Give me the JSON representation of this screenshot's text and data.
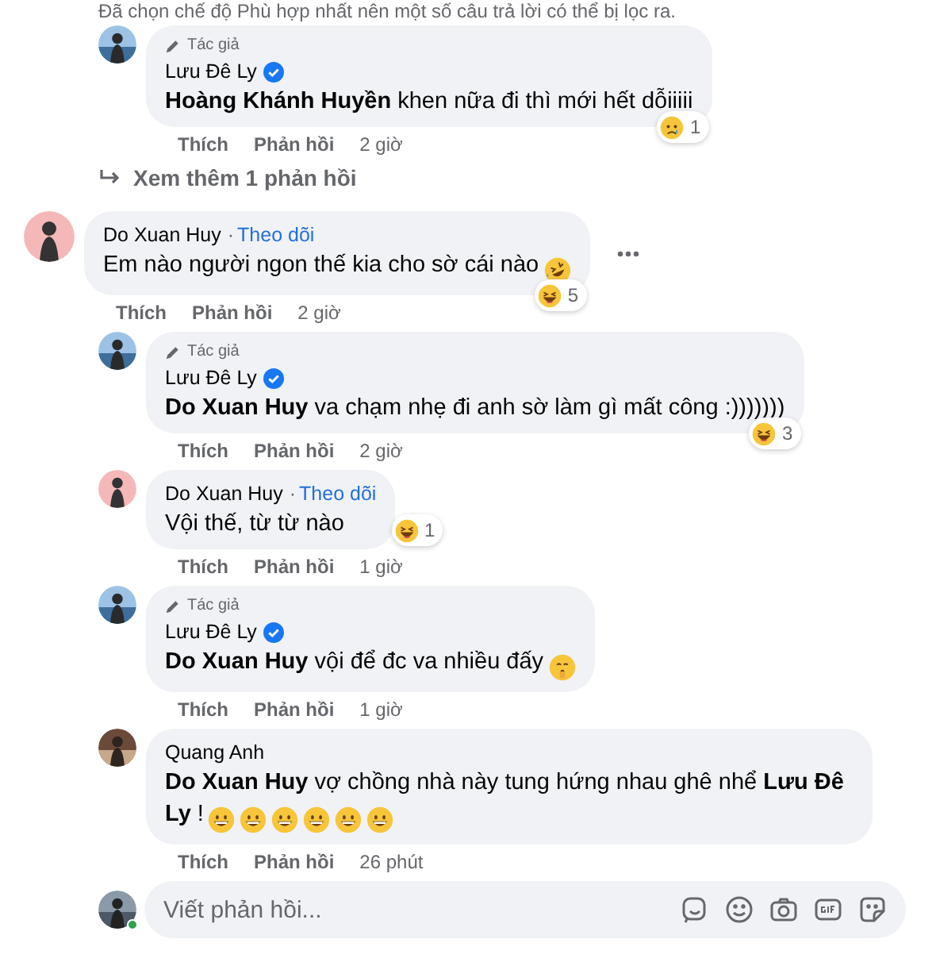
{
  "filter_notice": "Đã chọn chế độ Phù hợp nhất nên một số câu trả lời có thể bị lọc ra.",
  "earlier_replies": [
    {
      "author_badge": "Tác giả",
      "author": "Lưu Đê Ly",
      "verified": true,
      "text": "**Hoàng Khánh Huyền** khen nữa đi thì mới hết dỗiiiii",
      "reaction": {
        "kind": "sad",
        "count": "1"
      },
      "actions": [
        "Thích",
        "Phản hồi"
      ],
      "time": "2 giờ"
    }
  ],
  "view_more": "Xem thêm 1 phản hồi",
  "comment": {
    "author": "Do Xuan Huy",
    "separator": "·",
    "follow": "Theo dõi",
    "text": "Em nào người ngon thế kia cho sờ cái nào",
    "emojis": [
      {
        "kind": "rofl"
      }
    ],
    "reaction": {
      "kind": "haha",
      "count": "5"
    },
    "actions": [
      "Thích",
      "Phản hồi"
    ],
    "time": "2 giờ",
    "children": [
      {
        "author_badge": "Tác giả",
        "author": "Lưu Đê Ly",
        "verified": true,
        "text": "**Do Xuan Huy** va chạm nhẹ đi anh sờ làm gì mất công :)))))))",
        "reaction": {
          "kind": "haha",
          "count": "3"
        },
        "actions": [
          "Thích",
          "Phản hồi"
        ],
        "time": "2 giờ"
      },
      {
        "author": "Do Xuan Huy",
        "separator": "·",
        "follow": "Theo dõi",
        "text": "Vội thế, từ từ nào",
        "reaction": {
          "kind": "haha",
          "count": "1"
        },
        "actions": [
          "Thích",
          "Phản hồi"
        ],
        "time": "1 giờ"
      },
      {
        "author_badge": "Tác giả",
        "author": "Lưu Đê Ly",
        "verified": true,
        "text": "**Do Xuan Huy** vội để đc va nhiều đấy",
        "emojis": [
          {
            "kind": "shush"
          }
        ],
        "actions": [
          "Thích",
          "Phản hồi"
        ],
        "time": "1 giờ"
      },
      {
        "author": "Quang Anh",
        "text": "**Do Xuan Huy** vợ chồng nhà này tung hứng nhau ghê nhể **Lưu Đê Ly** !",
        "emojis": [
          {
            "kind": "grin"
          },
          {
            "kind": "grin"
          },
          {
            "kind": "grin"
          },
          {
            "kind": "grin"
          },
          {
            "kind": "grin"
          },
          {
            "kind": "grin"
          }
        ],
        "actions": [
          "Thích",
          "Phản hồi"
        ],
        "time": "26 phút"
      }
    ]
  },
  "reply_box": {
    "placeholder": "Viết phản hồi...",
    "online": true
  }
}
